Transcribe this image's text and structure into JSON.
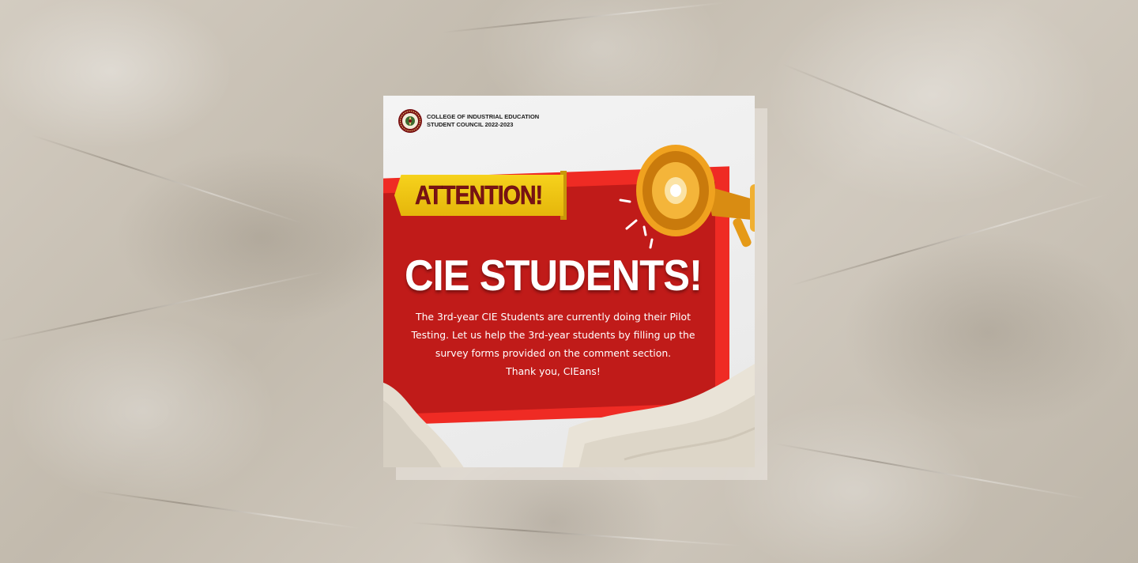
{
  "poster": {
    "org_line1": "COLLEGE OF INDUSTRIAL EDUCATION",
    "org_line2": "STUDENT COUNCIL 2022-2023",
    "banner": "ATTENTION!",
    "headline": "CIE STUDENTS!",
    "body_lines": [
      "The 3rd-year CIE Students are currently doing their Pilot",
      "Testing. Let us help the 3rd-year students by filling up the",
      "survey forms provided on the comment section.",
      "Thank you, CIEans!"
    ]
  },
  "colors": {
    "accent_red": "#ef2b24",
    "dark_red": "#c01b19",
    "banner_yellow": "#f6d21c",
    "banner_text": "#7a1214",
    "megaphone_orange": "#f0a21f"
  },
  "icons": {
    "logo": "college-seal-icon",
    "megaphone": "megaphone-icon"
  }
}
